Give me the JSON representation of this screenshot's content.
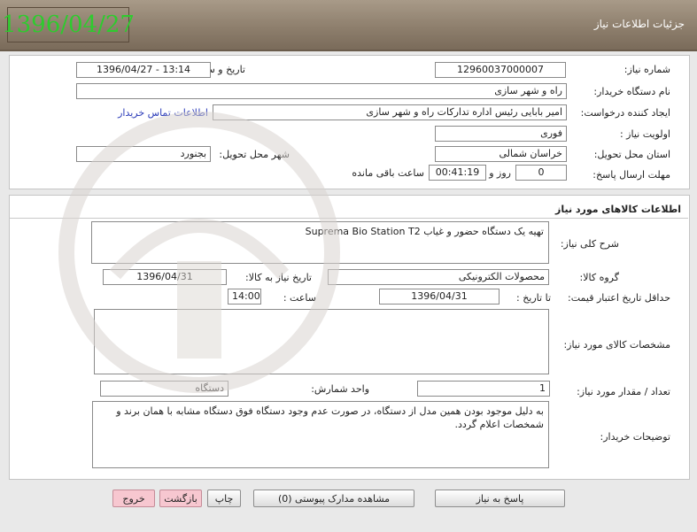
{
  "header": {
    "title": "جزئیات اطلاعات نیاز",
    "date": "1396/04/27"
  },
  "info": {
    "need_number_label": "شماره نیاز:",
    "need_number": "12960037000007",
    "announce_label": "تاریخ و ساعت اعلان عمومی:",
    "announce_value": "1396/04/27 - 13:14",
    "buyer_label": "نام دستگاه خریدار:",
    "buyer_value": "راه  و شهر سازی",
    "creator_label": "ایجاد کننده درخواست:",
    "creator_value": "امیر بابایی رئیس اداره تدارکات راه  و شهر سازی",
    "contact_link": "اطلاعات تماس خریدار",
    "priority_label": "اولویت نیاز :",
    "priority_value": "فوری",
    "province_label": "استان محل تحویل:",
    "province_value": "خراسان شمالی",
    "city_label": "شهر محل تحویل:",
    "city_value": "بجنورد",
    "deadline_label": "مهلت ارسال پاسخ:",
    "days_value": "0",
    "days_label": "روز و",
    "time_value": "00:41:19",
    "remaining_label": "ساعت باقی مانده"
  },
  "goods": {
    "section_title": "اطلاعات کالاهای مورد نیاز",
    "desc_label": "شرح کلی نیاز:",
    "desc_value": "تهیه یک دستگاه حضور و غیاب Suprema Bio Station T2",
    "group_label": "گروه کالا:",
    "group_value": "محصولات الکترونیکی",
    "need_date_label": "تاریخ نیاز به کالا:",
    "need_date_value": "1396/04/31",
    "min_validity_label": "حداقل تاریخ اعتبار قیمت:",
    "until_label": "تا تاریخ :",
    "until_value": "1396/04/31",
    "hour_label": "ساعت :",
    "hour_value": "14:00",
    "specs_label": "مشخصات کالای مورد نیاز:",
    "specs_value": "",
    "qty_label": "تعداد / مقدار مورد نیاز:",
    "qty_value": "1",
    "unit_label": "واحد شمارش:",
    "unit_value": "دستگاه",
    "buyer_notes_label": "توضیحات خریدار:",
    "buyer_notes_value": "به دلیل موجود بودن همین مدل از دستگاه، در صورت عدم وجود دستگاه فوق دستگاه مشابه با همان برند و شمخصات اعلام گردد."
  },
  "buttons": {
    "reply": "پاسخ به نیاز",
    "attachments": "مشاهده مدارک پیوستی (0)",
    "print": "چاپ",
    "back": "بازگشت",
    "exit": "خروج"
  }
}
